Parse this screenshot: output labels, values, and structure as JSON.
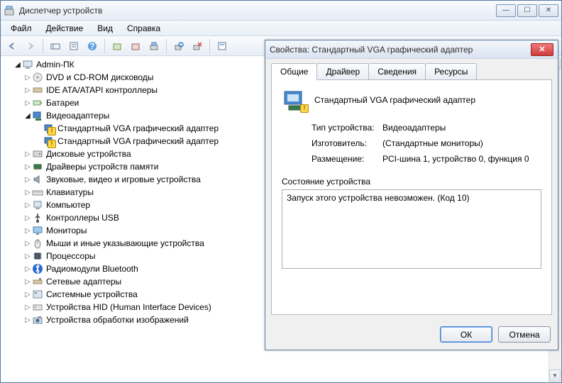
{
  "window": {
    "title": "Диспетчер устройств"
  },
  "menu": {
    "file": "Файл",
    "action": "Действие",
    "view": "Вид",
    "help": "Справка"
  },
  "tree": {
    "root": "Admin-ПК",
    "items": [
      {
        "label": "DVD и CD-ROM дисководы",
        "expanded": false
      },
      {
        "label": "IDE ATA/ATAPI контроллеры",
        "expanded": false
      },
      {
        "label": "Батареи",
        "expanded": false
      },
      {
        "label": "Видеоадаптеры",
        "expanded": true,
        "children": [
          {
            "label": "Стандартный VGA графический адаптер",
            "warning": true
          },
          {
            "label": "Стандартный VGA графический адаптер",
            "warning": true
          }
        ]
      },
      {
        "label": "Дисковые устройства",
        "expanded": false
      },
      {
        "label": "Драйверы устройств памяти",
        "expanded": false
      },
      {
        "label": "Звуковые, видео и игровые устройства",
        "expanded": false
      },
      {
        "label": "Клавиатуры",
        "expanded": false
      },
      {
        "label": "Компьютер",
        "expanded": false
      },
      {
        "label": "Контроллеры USB",
        "expanded": false
      },
      {
        "label": "Мониторы",
        "expanded": false
      },
      {
        "label": "Мыши и иные указывающие устройства",
        "expanded": false
      },
      {
        "label": "Процессоры",
        "expanded": false
      },
      {
        "label": "Радиомодули Bluetooth",
        "expanded": false
      },
      {
        "label": "Сетевые адаптеры",
        "expanded": false
      },
      {
        "label": "Системные устройства",
        "expanded": false
      },
      {
        "label": "Устройства HID (Human Interface Devices)",
        "expanded": false
      },
      {
        "label": "Устройства обработки изображений",
        "expanded": false
      }
    ]
  },
  "dialog": {
    "title": "Свойства: Стандартный VGA графический адаптер",
    "tabs": {
      "general": "Общие",
      "driver": "Драйвер",
      "details": "Сведения",
      "resources": "Ресурсы"
    },
    "device_name": "Стандартный VGA графический адаптер",
    "fields": {
      "type_label": "Тип устройства:",
      "type_value": "Видеоадаптеры",
      "mfr_label": "Изготовитель:",
      "mfr_value": "(Стандартные мониторы)",
      "loc_label": "Размещение:",
      "loc_value": "PCI-шина 1, устройство 0, функция 0"
    },
    "status_label": "Состояние устройства",
    "status_value": "Запуск этого устройства невозможен. (Код 10)",
    "buttons": {
      "ok": "ОК",
      "cancel": "Отмена"
    }
  }
}
